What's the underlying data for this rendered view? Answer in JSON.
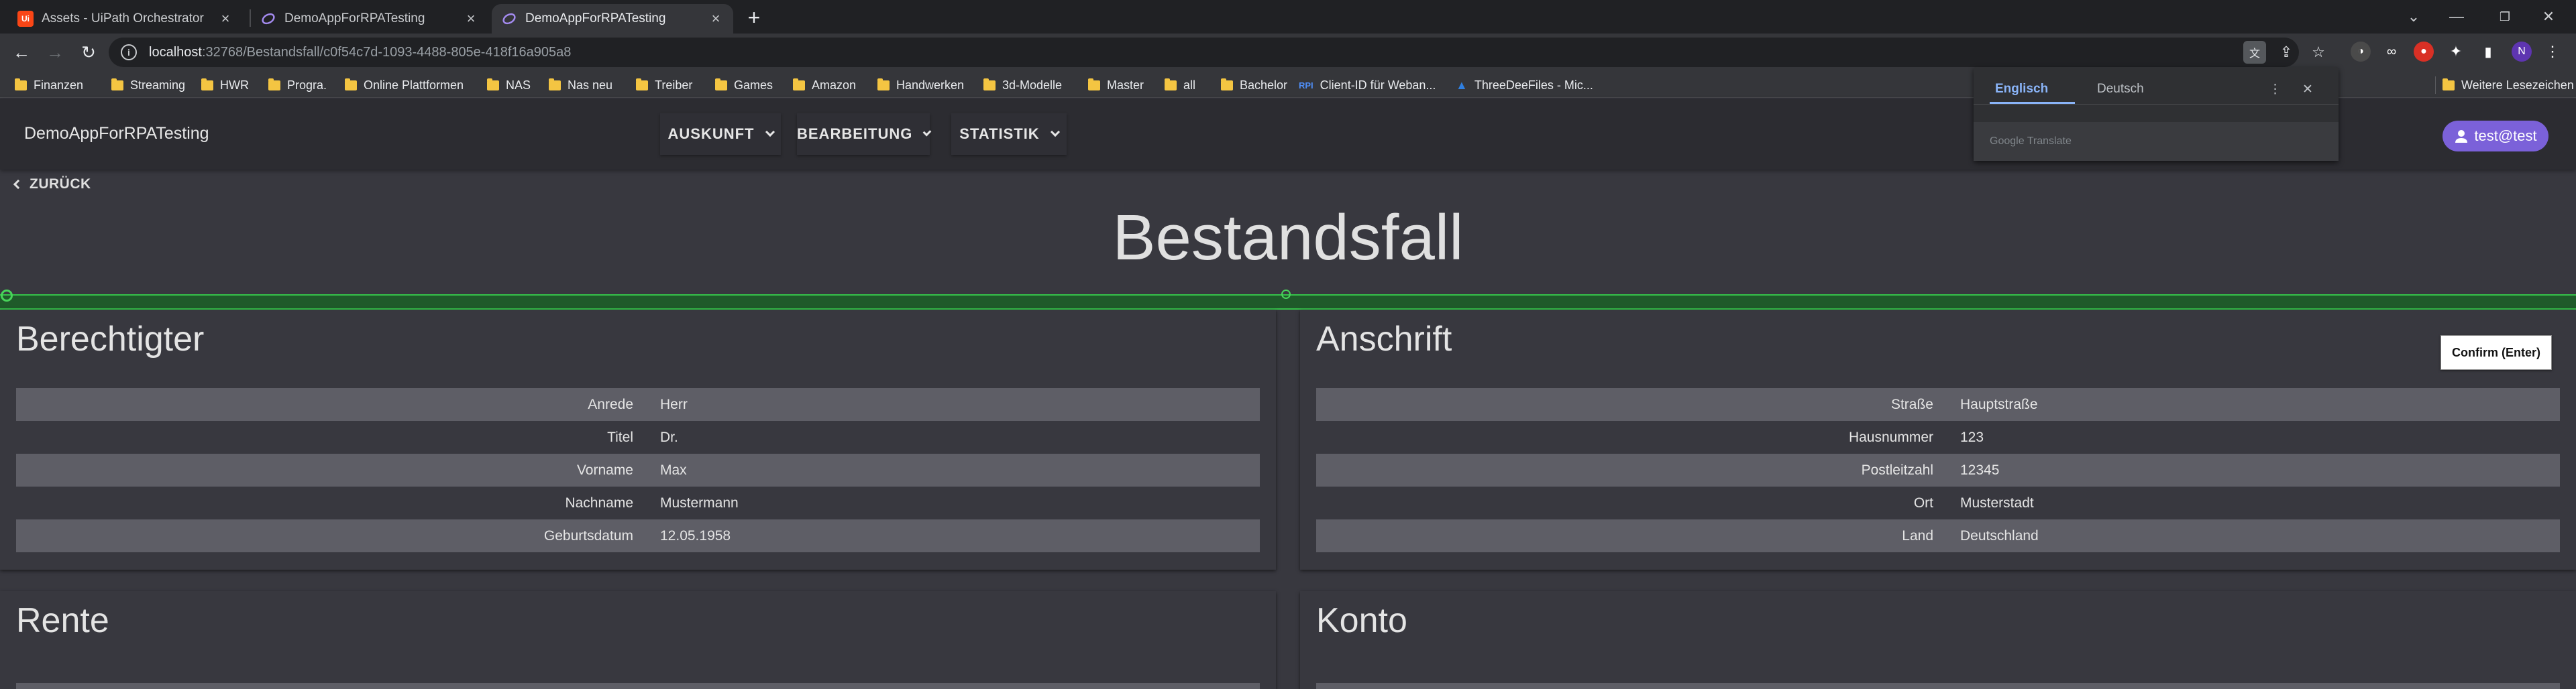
{
  "browser": {
    "tabs": [
      {
        "title": "Assets - UiPath Orchestrator",
        "icon": "uipath-icon"
      },
      {
        "title": "DemoAppForRPATesting",
        "icon": "app-icon"
      },
      {
        "title": "DemoAppForRPATesting",
        "icon": "app-icon"
      }
    ],
    "url_host": "localhost",
    "url_path": ":32768/Bestandsfall/c0f54c7d-1093-4488-805e-418f16a905a8",
    "bookmarks": [
      "Finanzen",
      "Streaming",
      "HWR",
      "Progra.",
      "Online Plattformen",
      "NAS",
      "Nas neu",
      "Treiber",
      "Games",
      "Amazon",
      "Handwerken",
      "3d-Modelle",
      "Master",
      "all",
      "Bachelor",
      "Client-ID für Weban...",
      "ThreeDeeFiles - Mic..."
    ],
    "bookmark_client_prefix": "RPI",
    "bookmarks_more": "Weitere Lesezeichen",
    "profile_initial": "N"
  },
  "translate_popup": {
    "lang_active": "Englisch",
    "lang_other": "Deutsch",
    "placeholder": "Google Translate"
  },
  "app": {
    "title": "DemoAppForRPATesting",
    "menus": [
      "AUSKUNFT",
      "BEARBEITUNG",
      "STATISTIK"
    ],
    "user": "test@test",
    "back_label": "ZURÜCK",
    "page_title": "Bestandsfall",
    "confirm_label": "Confirm (Enter)",
    "accent_color": "#7b61d9"
  },
  "sections": {
    "berechtigter": {
      "title": "Berechtigter",
      "rows": [
        {
          "label": "Anrede",
          "value": "Herr"
        },
        {
          "label": "Titel",
          "value": "Dr."
        },
        {
          "label": "Vorname",
          "value": "Max"
        },
        {
          "label": "Nachname",
          "value": "Mustermann"
        },
        {
          "label": "Geburtsdatum",
          "value": "12.05.1958"
        }
      ]
    },
    "anschrift": {
      "title": "Anschrift",
      "rows": [
        {
          "label": "Straße",
          "value": "Hauptstraße"
        },
        {
          "label": "Hausnummer",
          "value": "123"
        },
        {
          "label": "Postleitzahl",
          "value": "12345"
        },
        {
          "label": "Ort",
          "value": "Musterstadt"
        },
        {
          "label": "Land",
          "value": "Deutschland"
        }
      ]
    },
    "rente": {
      "title": "Rente"
    },
    "konto": {
      "title": "Konto"
    }
  }
}
